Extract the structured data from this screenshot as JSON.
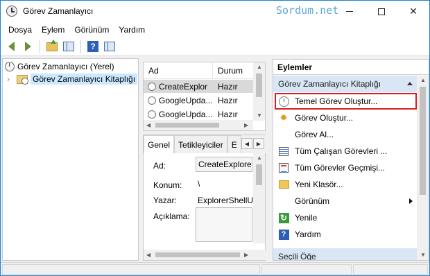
{
  "window": {
    "title": "Görev Zamanlayıcı",
    "watermark": "Sordum.net"
  },
  "menubar": {
    "items": [
      "Dosya",
      "Eylem",
      "Görünüm",
      "Yardım"
    ]
  },
  "toolbar": {
    "icons": [
      "back-arrow-icon",
      "forward-arrow-icon",
      "folder-up-icon",
      "show-hide-tree-icon",
      "help-icon",
      "show-hide-action-pane-icon"
    ]
  },
  "tree": {
    "root_label": "Görev Zamanlayıcı (Yerel)",
    "child_label": "Görev Zamanlayıcı Kitaplığı"
  },
  "tasklist": {
    "columns": [
      "Ad",
      "Durum"
    ],
    "rows": [
      {
        "name": "CreateExplor",
        "status": "Hazır"
      },
      {
        "name": "GoogleUpda...",
        "status": "Hazır"
      },
      {
        "name": "GoogleUpda...",
        "status": "Hazır"
      }
    ]
  },
  "details": {
    "tabs": [
      "Genel",
      "Tetikleyiciler",
      "E"
    ],
    "fields": {
      "name_label": "Ad:",
      "name_value": "CreateExplorer",
      "location_label": "Konum:",
      "location_value": "\\",
      "author_label": "Yazar:",
      "author_value": "ExplorerShellU",
      "description_label": "Açıklama:"
    }
  },
  "actions": {
    "header": "Eylemler",
    "group_label": "Görev Zamanlayıcı Kitaplığı",
    "items": [
      {
        "label": "Temel Görev Oluştur...",
        "icon": "clock-wand-icon"
      },
      {
        "label": "Görev Oluştur...",
        "icon": "create-task-icon"
      },
      {
        "label": "Görev Al...",
        "icon": ""
      },
      {
        "label": "Tüm Çalışan Görevleri ...",
        "icon": "running-tasks-icon"
      },
      {
        "label": "Tüm Görevler Geçmişi...",
        "icon": "history-icon"
      },
      {
        "label": "Yeni Klasör...",
        "icon": "new-folder-icon"
      },
      {
        "label": "Görünüm",
        "icon": ""
      },
      {
        "label": "Yenile",
        "icon": "refresh-icon"
      },
      {
        "label": "Yardım",
        "icon": "help-icon"
      }
    ],
    "selected_group_label": "Seçili Öğe"
  },
  "colors": {
    "highlight_border": "#d81f1f",
    "group_header_bg": "#d9e6f5",
    "tree_selected_bg": "#cce8ff"
  }
}
